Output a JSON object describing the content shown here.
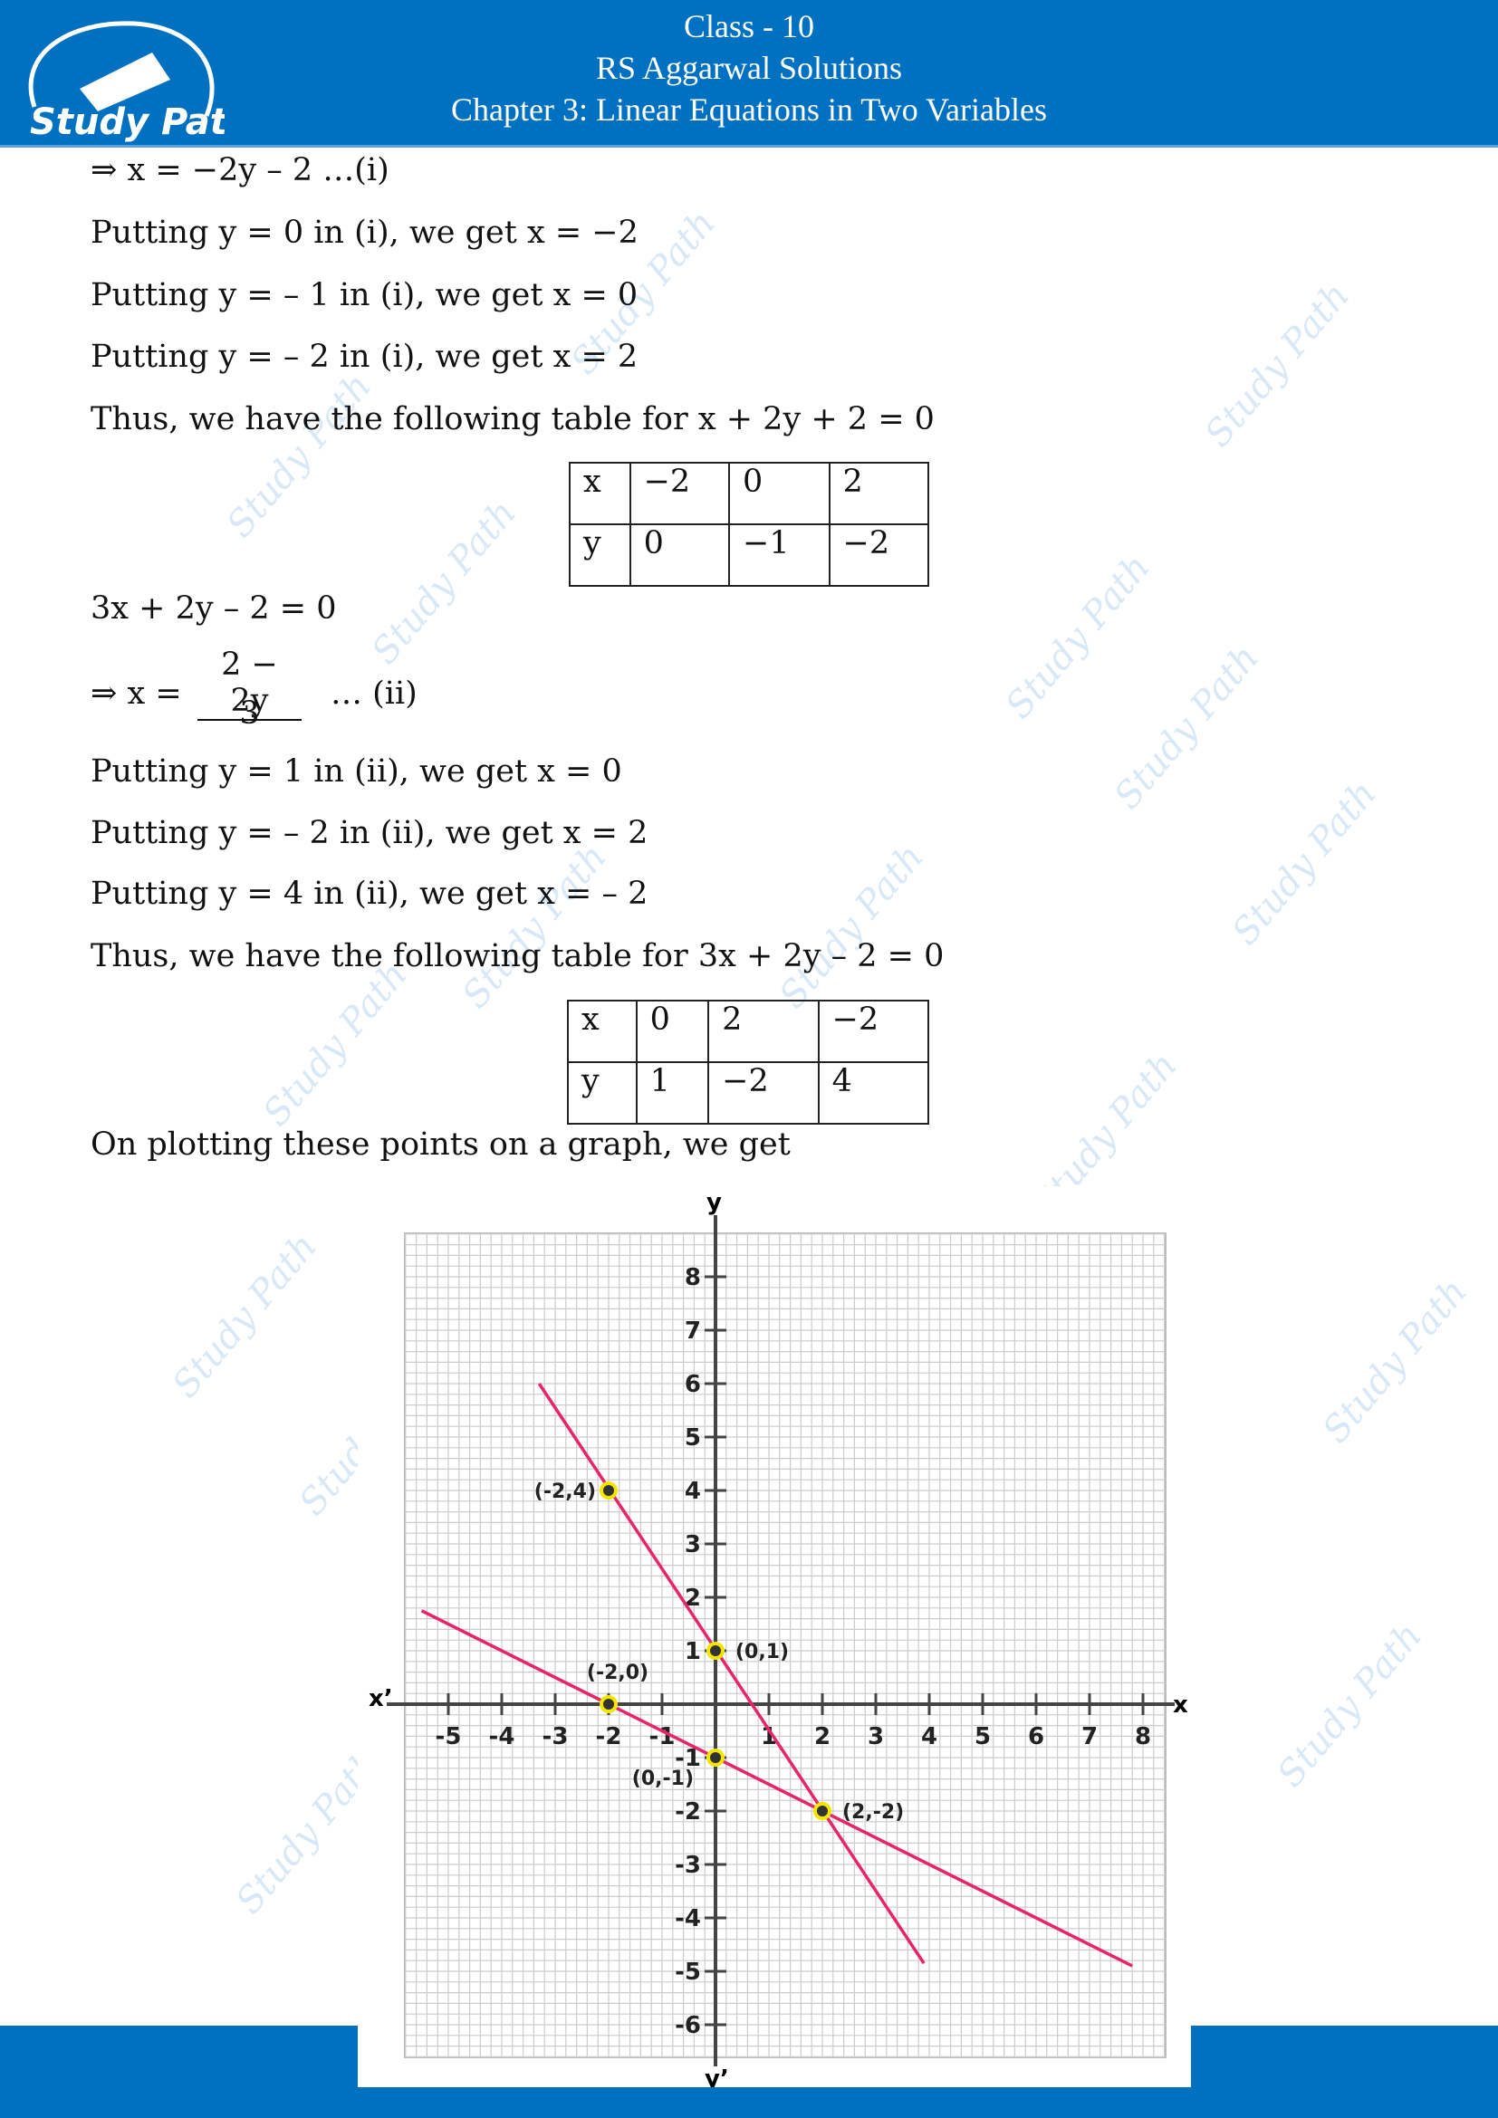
{
  "header": {
    "line1": "Class - 10",
    "line2": "RS Aggarwal Solutions",
    "line3": "Chapter 3: Linear Equations in Two Variables",
    "logo_text": "Study Path"
  },
  "watermark": "Study Path",
  "content": {
    "l1": "⇒ x = −2y – 2          …(i)",
    "l2": "Putting y = 0 in (i), we get x = −2",
    "l3": "Putting y = – 1 in (i), we get x = 0",
    "l4": "Putting y = – 2 in (i), we get x = 2",
    "l5": "Thus, we have the following table for x + 2y + 2 = 0",
    "table1": [
      [
        "x",
        "−2",
        "0",
        "2"
      ],
      [
        "y",
        "0",
        "−1",
        "−2"
      ]
    ],
    "l6": "3x + 2y – 2 = 0",
    "frac_prefix": "⇒ x  =",
    "frac_num": "2 − 2y",
    "frac_den": "3",
    "frac_suffix": "… (ii)",
    "l7": "Putting y = 1 in (ii), we get x = 0",
    "l8": "Putting y = – 2 in (ii), we get x = 2",
    "l9": "Putting y = 4 in (ii), we get x = – 2",
    "l10": "Thus, we have the following table for 3x + 2y – 2 = 0",
    "table2": [
      [
        "x",
        "0",
        "2",
        "−2"
      ],
      [
        "y",
        "1",
        "−2",
        "4"
      ]
    ],
    "l11": "On plotting these points on a graph, we get"
  },
  "chart_data": {
    "type": "line",
    "xlabel": "x",
    "xlabel_neg": "x’",
    "ylabel": "y",
    "ylabel_neg": "y’",
    "xlim": [
      -5.6,
      8.6
    ],
    "ylim": [
      -6.6,
      9.2
    ],
    "xticks": [
      -5,
      -4,
      -3,
      -2,
      -1,
      1,
      2,
      3,
      4,
      5,
      6,
      7,
      8
    ],
    "yticks": [
      -6,
      -5,
      -4,
      -3,
      -2,
      -1,
      1,
      2,
      3,
      4,
      5,
      6,
      7,
      8
    ],
    "grid": true,
    "minor_per_unit": 5,
    "line_color": "#e8246a",
    "point_color": "#f2e600",
    "series": [
      {
        "equation": "x + 2y + 2 = 0",
        "x": [
          -5.5,
          7.8
        ],
        "y": [
          1.75,
          -4.9
        ]
      },
      {
        "equation": "3x + 2y – 2 = 0",
        "x": [
          -3.3,
          3.9
        ],
        "y": [
          6,
          -4.85
        ]
      }
    ],
    "points": [
      {
        "x": -2,
        "y": 4,
        "label": "(-2,4)",
        "anchor": "left"
      },
      {
        "x": 0,
        "y": 1,
        "label": "(0,1)",
        "anchor": "right"
      },
      {
        "x": -2,
        "y": 0,
        "label": "(-2,0)",
        "anchor": "top"
      },
      {
        "x": 0,
        "y": -1,
        "label": "(0,-1)",
        "anchor": "below-left"
      },
      {
        "x": 2,
        "y": -2,
        "label": "(2,-2)",
        "anchor": "right"
      }
    ]
  }
}
